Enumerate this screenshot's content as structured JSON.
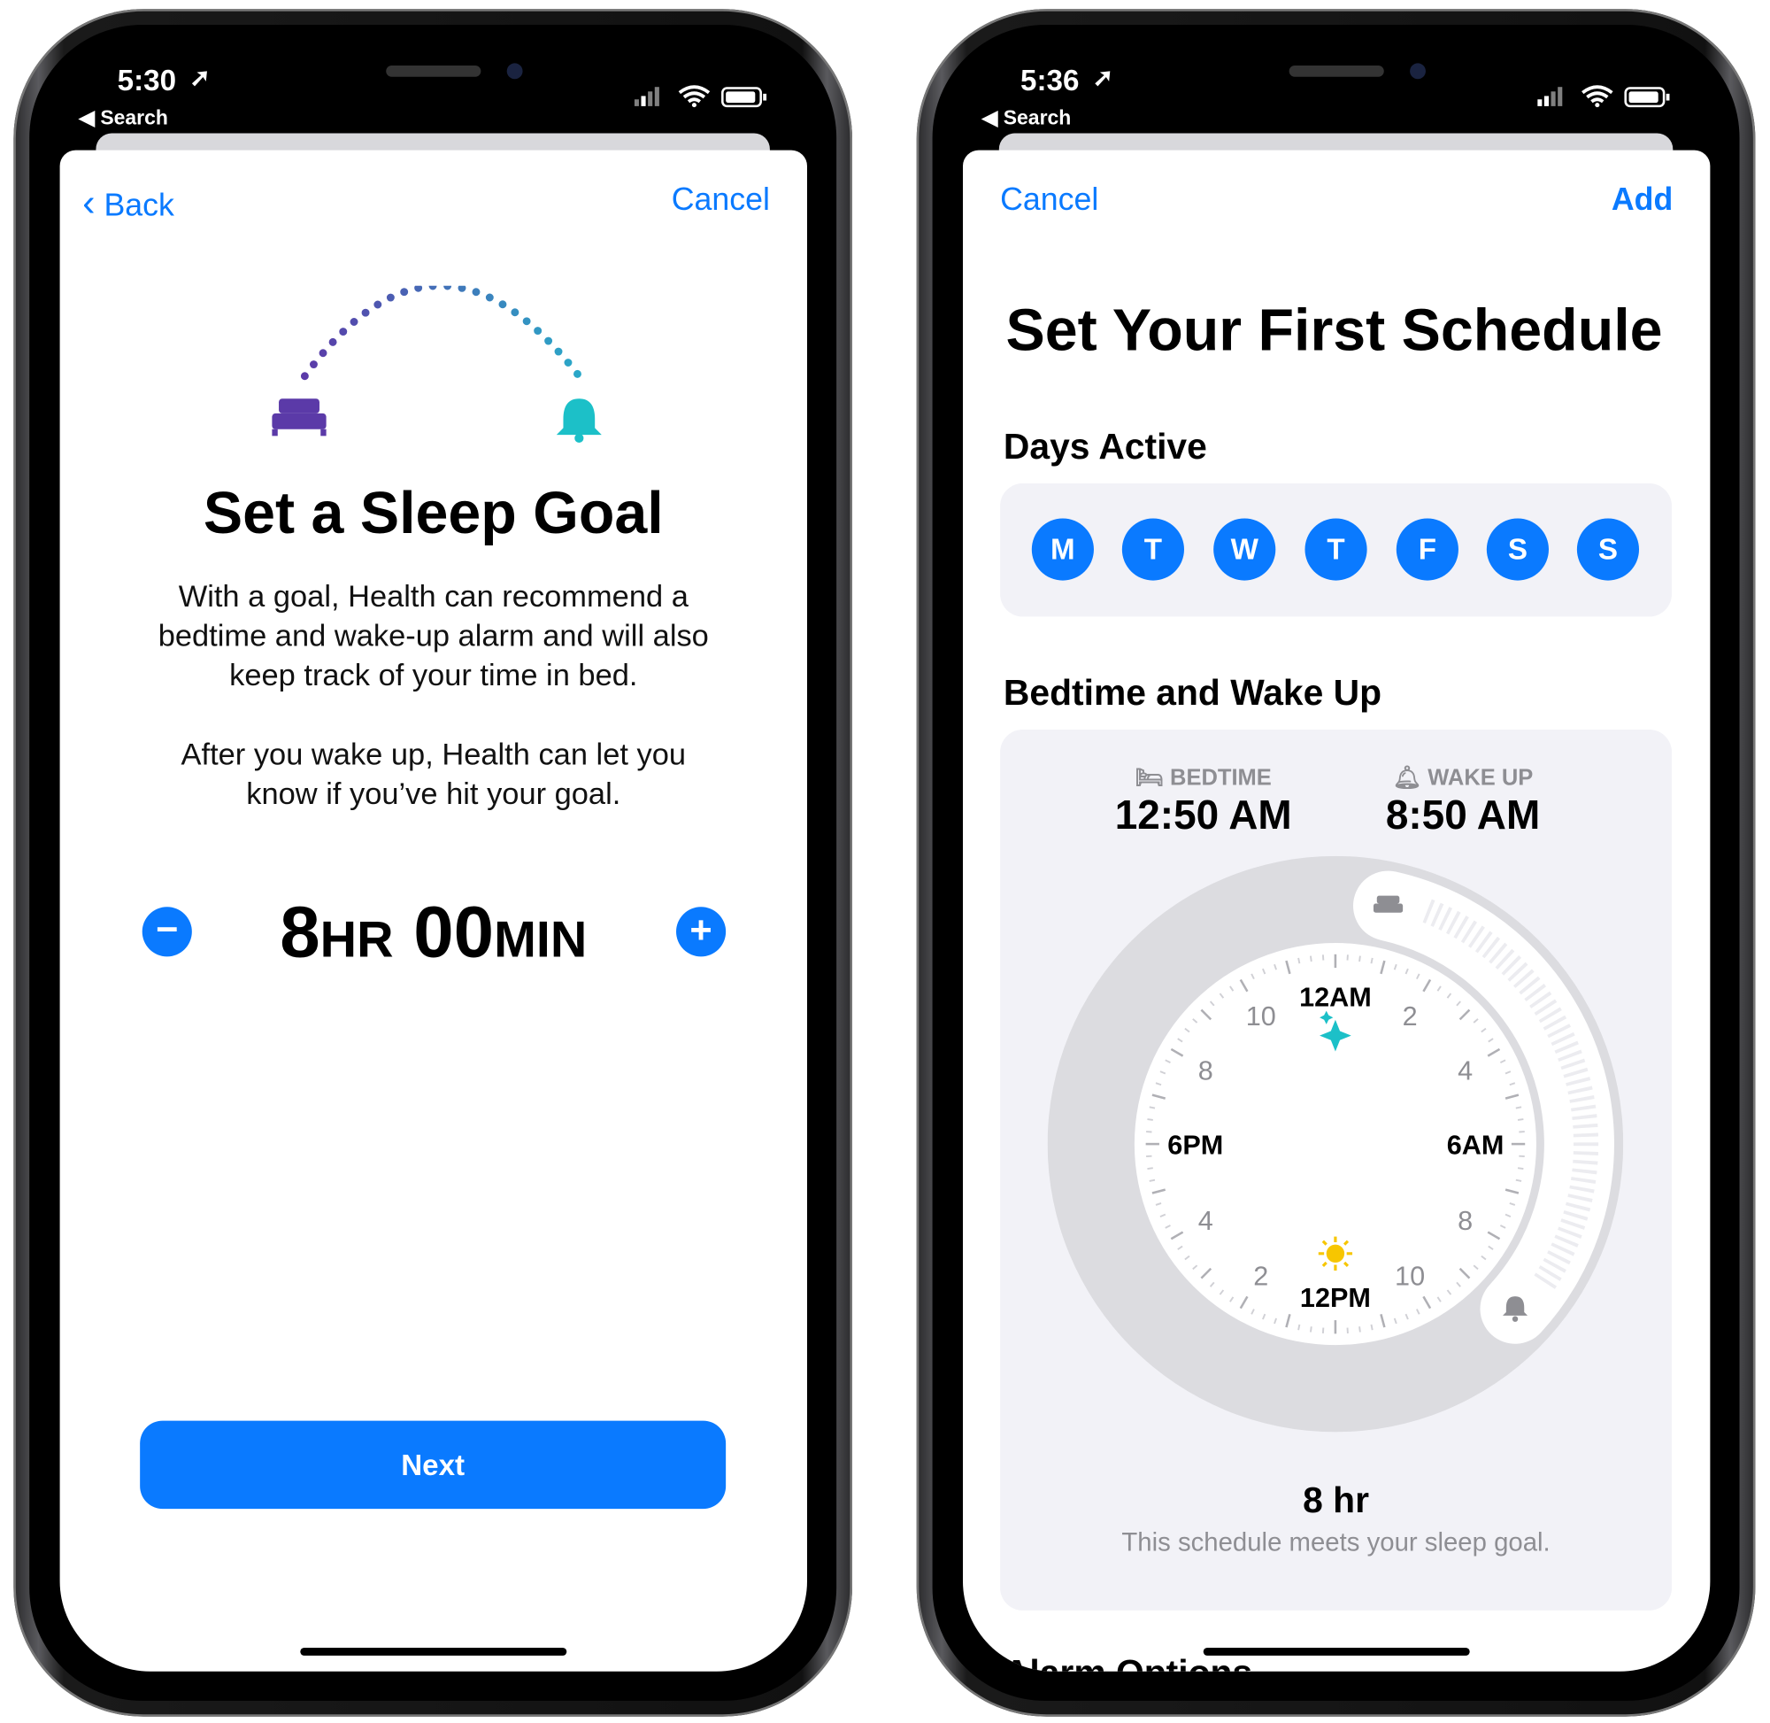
{
  "left": {
    "status": {
      "time": "5:30",
      "back": "◀ Search"
    },
    "nav": {
      "back": "Back",
      "cancel": "Cancel"
    },
    "title": "Set a Sleep Goal",
    "paragraph1": [
      "With a goal, Health can recommend a",
      "bedtime and wake-up alarm and will also",
      "keep track of your time in bed."
    ],
    "paragraph2": [
      "After you wake up, Health can let you",
      "know if you’ve hit your goal."
    ],
    "goal": {
      "hours": "8",
      "hr_unit": "hr",
      "minutes": "00",
      "min_unit": "min"
    },
    "next": "Next",
    "colors": {
      "accent": "#0a7aff",
      "bed": "#5b3aa8",
      "bell": "#1cc0c8"
    }
  },
  "right": {
    "status": {
      "time": "5:36",
      "back": "◀ Search"
    },
    "nav": {
      "cancel": "Cancel",
      "add": "Add"
    },
    "title": "Set Your First Schedule",
    "days_heading": "Days Active",
    "days": [
      "M",
      "T",
      "W",
      "T",
      "F",
      "S",
      "S"
    ],
    "bedtime_heading": "Bedtime and Wake Up",
    "bedtime": {
      "label": "BEDTIME",
      "value": "12:50 AM"
    },
    "wake": {
      "label": "WAKE UP",
      "value": "8:50 AM"
    },
    "clock": {
      "labels": {
        "12am": "12AM",
        "2": "2",
        "4": "4",
        "6am": "6AM",
        "8": "8",
        "10": "10",
        "12pm": "12PM",
        "2b": "2",
        "4b": "4",
        "6pm": "6PM",
        "8b": "8",
        "10b": "10"
      },
      "bedtime_hour": 0.8333,
      "wake_hour": 8.8333
    },
    "duration": "8 hr",
    "summary": "This schedule meets your sleep goal.",
    "cut_heading": "Alarm Options"
  }
}
